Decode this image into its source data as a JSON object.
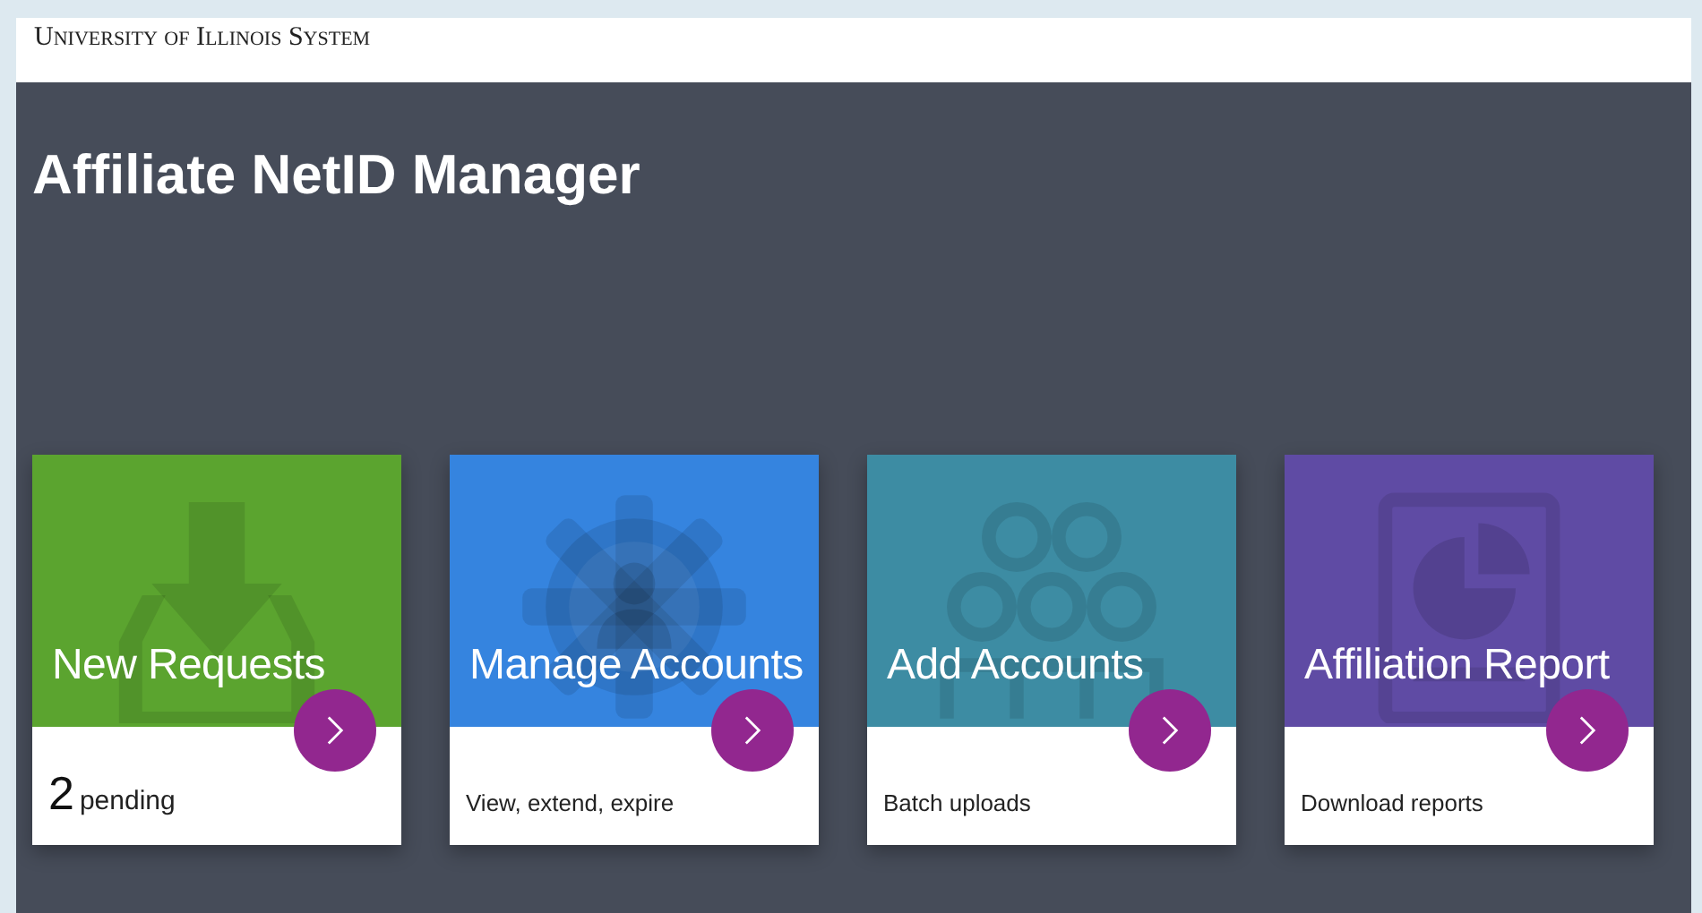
{
  "header": {
    "brand": "University of Illinois System"
  },
  "title": "Affiliate NetID Manager",
  "cards": [
    {
      "title": "New Requests",
      "color": "#5ba42f",
      "kind": "count",
      "count": "2",
      "caption": "pending"
    },
    {
      "title": "Manage Accounts",
      "color": "#3584df",
      "kind": "text",
      "caption": "View, extend, expire"
    },
    {
      "title": "Add Accounts",
      "color": "#3d8ca3",
      "kind": "text",
      "caption": "Batch uploads"
    },
    {
      "title": "Affiliation Report",
      "color": "#5f4ba4",
      "kind": "text",
      "caption": "Download reports"
    }
  ]
}
